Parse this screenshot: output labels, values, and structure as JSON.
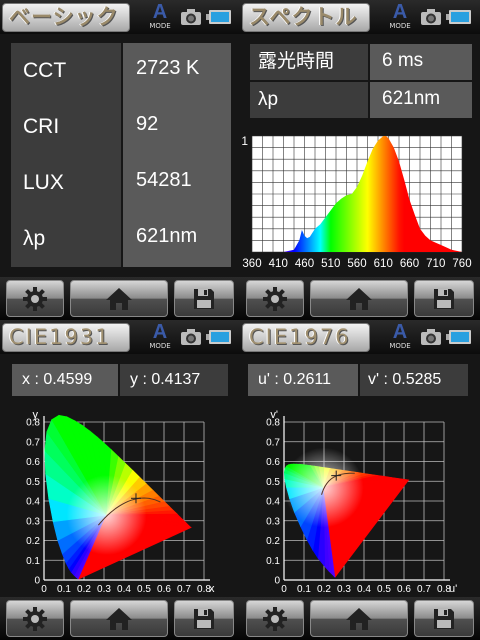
{
  "basic": {
    "title": "ベーシック",
    "mode_label": "A",
    "mode_sub": "MODE",
    "rows": [
      {
        "key": "CCT",
        "value": "2723 K"
      },
      {
        "key": "CRI",
        "value": "92"
      },
      {
        "key": "LUX",
        "value": "54281"
      },
      {
        "key": "λp",
        "value": "621nm"
      }
    ]
  },
  "spectrum": {
    "title": "スペクトル",
    "mode_label": "A",
    "mode_sub": "MODE",
    "rows": [
      {
        "key": "露光時間",
        "value": "6 ms"
      },
      {
        "key": "λp",
        "value": "621nm"
      }
    ],
    "chart_data": {
      "type": "area",
      "title": "",
      "xlabel": "",
      "ylabel": "",
      "xlim": [
        360,
        760
      ],
      "ylim": [
        0,
        1
      ],
      "y_tick_labels": [
        "1"
      ],
      "x_tick_labels": [
        "360",
        "410",
        "460",
        "510",
        "560",
        "610",
        "660",
        "710",
        "760"
      ],
      "grid": true,
      "series": [
        {
          "x": [
            380,
            400,
            420,
            440,
            450,
            455,
            460,
            465,
            470,
            480,
            490,
            500,
            510,
            520,
            530,
            540,
            550,
            560,
            570,
            580,
            590,
            600,
            610,
            615,
            620,
            630,
            640,
            650,
            660,
            670,
            680,
            690,
            700,
            710,
            720,
            730,
            740,
            760
          ],
          "values": [
            0,
            0,
            0,
            0.02,
            0.1,
            0.19,
            0.14,
            0.12,
            0.13,
            0.2,
            0.24,
            0.3,
            0.36,
            0.42,
            0.46,
            0.49,
            0.5,
            0.56,
            0.66,
            0.78,
            0.89,
            0.96,
            1.0,
            1.0,
            0.98,
            0.9,
            0.78,
            0.62,
            0.45,
            0.32,
            0.2,
            0.14,
            0.1,
            0.08,
            0.06,
            0.04,
            0.02,
            0
          ]
        }
      ]
    }
  },
  "cie1931": {
    "title": "CIE1931",
    "mode_label": "A",
    "mode_sub": "MODE",
    "x_label": "x : 0.4599",
    "y_label": "y : 0.4137",
    "axis_x": "x",
    "axis_y": "y",
    "chart_data": {
      "type": "scatter",
      "title": "",
      "xlabel": "x",
      "ylabel": "y",
      "xlim": [
        0,
        0.8
      ],
      "ylim": [
        0,
        0.8
      ],
      "x_tick_labels": [
        "0",
        "0.1",
        "0.2",
        "0.3",
        "0.4",
        "0.5",
        "0.6",
        "0.7",
        "0.8"
      ],
      "y_tick_labels": [
        "0",
        "0.1",
        "0.2",
        "0.3",
        "0.4",
        "0.5",
        "0.6",
        "0.7",
        "0.8"
      ],
      "grid": true,
      "series": [
        {
          "x": [
            0.4599
          ],
          "values": [
            0.4137
          ]
        }
      ]
    }
  },
  "cie1976": {
    "title": "CIE1976",
    "mode_label": "A",
    "mode_sub": "MODE",
    "u_label": "u' : 0.2611",
    "v_label": "v' : 0.5285",
    "axis_x": "u'",
    "axis_y": "v'",
    "chart_data": {
      "type": "scatter",
      "title": "",
      "xlabel": "u'",
      "ylabel": "v'",
      "xlim": [
        0,
        0.8
      ],
      "ylim": [
        0,
        0.8
      ],
      "x_tick_labels": [
        "0",
        "0.1",
        "0.2",
        "0.3",
        "0.4",
        "0.5",
        "0.6",
        "0.7",
        "0.8"
      ],
      "y_tick_labels": [
        "0",
        "0.1",
        "0.2",
        "0.3",
        "0.4",
        "0.5",
        "0.6",
        "0.7",
        "0.8"
      ],
      "grid": true,
      "series": [
        {
          "x": [
            0.2611
          ],
          "values": [
            0.5285
          ]
        }
      ]
    }
  },
  "buttons": {
    "settings": "gear-icon",
    "home": "home-icon",
    "save": "floppy-icon"
  },
  "colors": {
    "accent_blue": "#3a5aa8",
    "title_text": "#9a8a6a",
    "battery": "#2aa0e0"
  }
}
